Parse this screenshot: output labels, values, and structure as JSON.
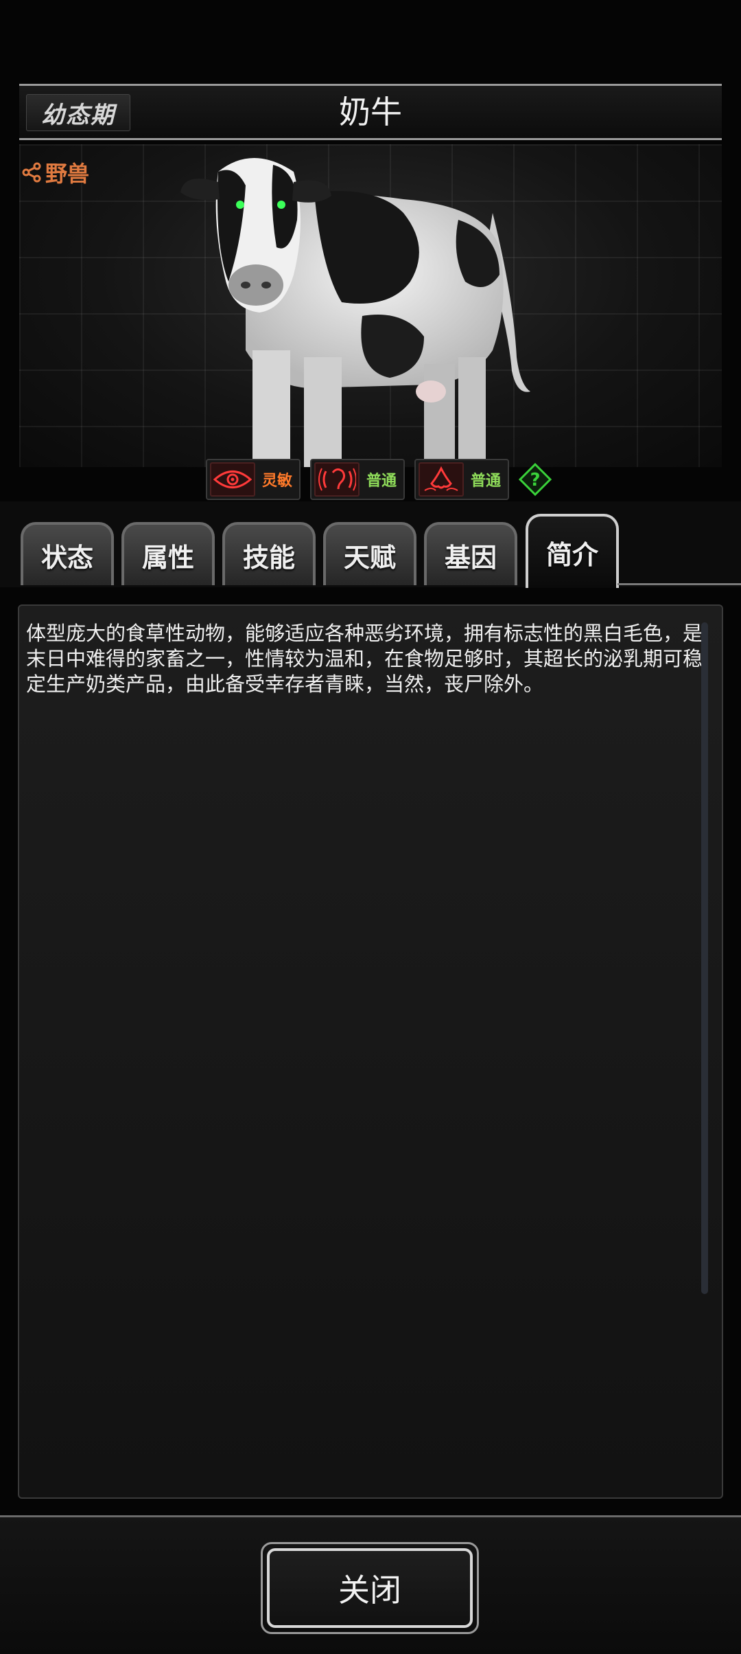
{
  "header": {
    "stage_label": "幼态期",
    "creature_name": "奶牛"
  },
  "category": {
    "icon": "share-icon",
    "label": "野兽"
  },
  "senses": [
    {
      "icon": "eye-icon",
      "label": "灵敏",
      "color": "#ff7a2a"
    },
    {
      "icon": "ear-icon",
      "label": "普通",
      "color": "#8fdc5a"
    },
    {
      "icon": "nose-icon",
      "label": "普通",
      "color": "#8fdc5a"
    }
  ],
  "help": {
    "icon": "help-icon",
    "glyph": "?",
    "color": "#3ad23a"
  },
  "tabs": [
    {
      "label": "状态"
    },
    {
      "label": "属性"
    },
    {
      "label": "技能"
    },
    {
      "label": "天赋"
    },
    {
      "label": "基因"
    },
    {
      "label": "简介",
      "active": true
    }
  ],
  "description": "体型庞大的食草性动物，能够适应各种恶劣环境，拥有标志性的黑白毛色，是末日中难得的家畜之一，性情较为温和，在食物足够时，其超长的泌乳期可稳定生产奶类产品，由此备受幸存者青睐，当然，丧尸除外。",
  "footer": {
    "close_label": "关闭"
  }
}
